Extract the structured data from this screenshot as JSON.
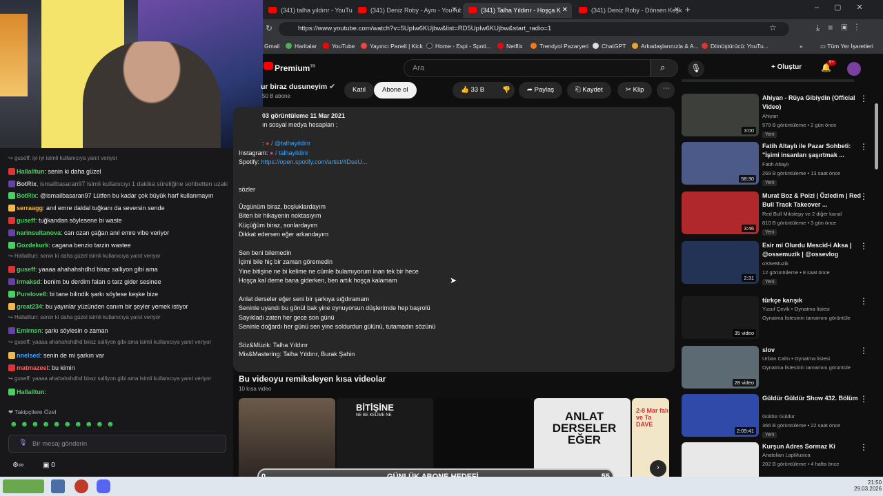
{
  "browser": {
    "tabs": [
      {
        "label": "(341) talha yıldırır - YouTube"
      },
      {
        "label": "(341) Deniz Roby - Aynı - YouTub"
      },
      {
        "label": "(341) Talha Yıldırır - Hoşça K"
      },
      {
        "label": "(341) Deniz Roby - Dönsen Keşk"
      }
    ],
    "url": "https://www.youtube.com/watch?v=5UpIw6KUjbw&list=RD5UpIw6KUjbw&start_radio=1",
    "bookmarks": [
      "Gmail",
      "Haritalar",
      "YouTube",
      "Yayıncı Paneli | Kick",
      "Home - Espi - Spoti...",
      "Netflix",
      "Trendyol Pazaryeri",
      "ChatGPT",
      "Arkadaşlarınızla & A...",
      "Dönüştürücü: YouTu..."
    ],
    "all_bookmarks": "Tüm Yer İşaretleri"
  },
  "youtube": {
    "premium": "Premium",
    "premium_sup": "TR",
    "search_placeholder": "Ara",
    "create_label": "Oluştur",
    "notif_count": "9+",
    "channel_name": "ur biraz dusuneyim",
    "subs": "50 B abone",
    "join": "Katıl",
    "subscribe": "Abone ol",
    "likes": "33 B",
    "share": "Paylaş",
    "save": "Kaydet",
    "clip": "Klip"
  },
  "description": {
    "stats": "03 görüntüleme  11 Mar 2021",
    "line1": "ın sosyal medya hesapları ;",
    "tiktok": ": ",
    "tiktok_handle": "/ @talhayildirir",
    "instagram": "Instagram: ",
    "instagram_handle": "/ talhayildirir",
    "spotify": "Spotify: ",
    "spotify_link": "https://open.spotify.com/artist/4DseU...",
    "lyrics_head": "sözler",
    "lyrics": [
      "Üzgünüm biraz, boşluklardayım",
      "Biten bir hikayenin noktasıyım",
      "Küçüğüm biraz, sonlardayım",
      "Dikkat edersen eğer arkandayım",
      "",
      "Sen beni bilemedin",
      "İçimi bile hiç bir zaman göremedin",
      "Yine bitişine ne bi kelime ne cümle bulamıyorum inan tek bir hece",
      "Hoşça kal deme bana giderken, ben artık hoşça kalamam",
      "",
      "Anlat derseler eğer seni bir şarkıya sığdıramam",
      "Seninle uyandı bu gönül bak yine oynuyorsun düşlerimde hep başrolü",
      "Sayıkladı zaten her gece son günü",
      "Seninle doğardı her günü sen yine soldurdun gülünü, tutamadın sözünü",
      "",
      "Söz&Müzik: Talha Yıldırır",
      "Mix&Mastering: Talha Yıldırır, Burak Şahin"
    ]
  },
  "shorts": {
    "title": "Bu videoyu remiksleyen kısa videolar",
    "sub": "10 kısa video",
    "overlays": [
      "",
      "BİTİŞİNE",
      "",
      "ANLAT DERSELER EĞER",
      "2-8 Mar falı ve Ta DAVE"
    ],
    "overlay2_sub": "NE BE KELİME NE"
  },
  "sidebar": [
    {
      "title": "Ahiyan - Rüya Gibiydin (Official Video)",
      "channel": "Ahiyan",
      "meta": "579 B görüntüleme • 2 gün önce",
      "badge": "Yeni",
      "dur": "3:00",
      "color": "#3c3f3a"
    },
    {
      "title": "Fatih Altaylı ile Pazar Sohbeti: \"İşimi insanları şaşırtmak ...",
      "channel": "Fatih Altaylı",
      "meta": "269 B görüntüleme • 13 saat önce",
      "badge": "Yeni",
      "dur": "58:30",
      "color": "#4b5a88"
    },
    {
      "title": "Murat Boz & Poizi | Özledim | Red Bull Track Takeover ...",
      "channel": "Red Bull Mikstepy",
      "meta": "810 B görüntüleme • 3 gün önce",
      "badge": "Yeni",
      "dur": "3:46",
      "color": "#b1282c",
      "extra": " ve 2 diğer kanal"
    },
    {
      "title": "Esir mi Olurdu Mescid-i Aksa | @ossemuzik | @ossevlog",
      "channel": "oSSeMuzik",
      "meta": "12 görüntüleme • 8 saat önce",
      "badge": "Yeni",
      "dur": "2:31",
      "color": "#223355"
    },
    {
      "title": "türkçe karışık",
      "channel": "Yusuf Çevik • Oynatma listesi",
      "meta": "Oynatma listesinin tamamını görüntüle",
      "badge": "",
      "dur": "35 video",
      "color": "#1a1a1a"
    },
    {
      "title": "slov",
      "channel": "Urban Calm • Oynatma listesi",
      "meta": "Oynatma listesinin tamamını görüntüle",
      "badge": "",
      "dur": "28 video",
      "color": "#5c6a74"
    },
    {
      "title": "Güldür Güldür Show 432. Bölüm",
      "channel": "Güldür Güldür",
      "meta": "366 B görüntüleme • 22 saat önce",
      "badge": "Yeni",
      "dur": "2:09:41",
      "color": "#2f4aa8"
    },
    {
      "title": "Kurşun Adres Sormaz Ki",
      "channel": "Anatolian LapMusica",
      "meta": "202 B görüntüleme • 4 hafta önce",
      "badge": "",
      "dur": "",
      "color": "#e8e8e8"
    }
  ],
  "chat": {
    "lines": [
      {
        "type": "reply",
        "text": "guseff: iyi iyi isimli kullanıcıya yanıt veriyor"
      },
      {
        "user": "Hallalltun",
        "color": "#46d160",
        "msg": ": senin ki daha güzel"
      },
      {
        "user": "BotRix",
        "color": "#c8c8c8",
        "msg": ", ismailbasaran97 isimli kullanıcıyı 1 dakika süreliğine sohbetten uzaklaştı",
        "dim": true
      },
      {
        "user": "BotRix",
        "color": "#46d160",
        "msg": ": @ismailbasaran97 Lütfen bu kadar çok büyük harf kullanmayın"
      },
      {
        "user": "serraagg",
        "color": "#f0b94a",
        "msg": ": anıl emre daldal tuğkanı da seversin sende"
      },
      {
        "user": "guseff",
        "color": "#46d160",
        "msg": ": tuğkandan söylesene bi waste"
      },
      {
        "user": "narinsultanova",
        "color": "#46d160",
        "msg": ": can ozan çağan anıl emre vibe veriyor"
      },
      {
        "user": "Gozdekurk",
        "color": "#46d160",
        "msg": ": cagana benzio tarzin wastee"
      },
      {
        "type": "reply",
        "text": "Hallalltun: senin ki daha güzel isimli kullanıcıya yanıt veriyor"
      },
      {
        "user": "guseff",
        "color": "#46d160",
        "msg": ": yaaaa ahahahshdhd biraz salliyon gibi ama"
      },
      {
        "user": "irmaksd",
        "color": "#46d160",
        "msg": ": benim bu derdim falan o tarz gider sesinee"
      },
      {
        "user": "Purelove6",
        "color": "#46d160",
        "msg": ": bi tane bilindik şarkı söylese keşke bize"
      },
      {
        "user": "great234",
        "color": "#46d160",
        "msg": ": bu yayınlar yüzünden canım bir şeyler yemek istiyor"
      },
      {
        "type": "reply",
        "text": "Hallalltun: senin ki daha güzel isimli kullanıcıya yanıt veriyor"
      },
      {
        "user": "Emirnsn",
        "color": "#46d160",
        "msg": ": şarkı söylesin o zaman"
      },
      {
        "type": "reply",
        "text": "guseff: yaaaa ahahahshdhd biraz salliyon gibi ama isimli kullanıcıya yanıt veriyor"
      },
      {
        "user": "nnelsed",
        "color": "#3ea6ff",
        "msg": ": senin de mi şarkın var"
      },
      {
        "user": "matmazeel",
        "color": "#f06a6a",
        "msg": ": bu kimin"
      },
      {
        "type": "reply",
        "text": "guseff: yaaaa ahahahshdhd biraz salliyon gibi ama isimli kullanıcıya yanıt veriyor"
      },
      {
        "user": "Hallalltun",
        "color": "#46d160",
        "msg": ": "
      }
    ],
    "emote_label": "Takipçilere Özel",
    "input_placeholder": "Bir mesaj gönderin",
    "points": "0"
  },
  "goal": {
    "label": "GÜNLÜK ABONE HEDEFİ",
    "current": "0",
    "target": "55"
  },
  "clock": {
    "time": "21:50",
    "date": "29.03.2026"
  }
}
